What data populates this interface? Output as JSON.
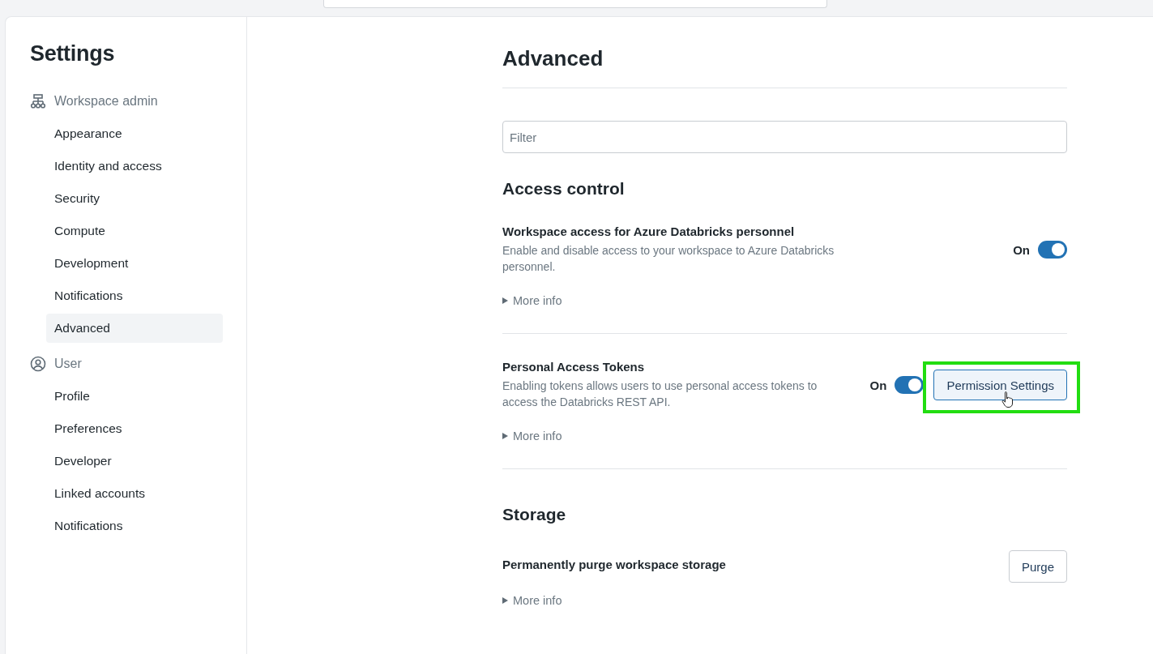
{
  "sidebar": {
    "title": "Settings",
    "groups": [
      {
        "label": "Workspace admin",
        "kind": "workspace",
        "items": [
          {
            "label": "Appearance",
            "selected": false
          },
          {
            "label": "Identity and access",
            "selected": false
          },
          {
            "label": "Security",
            "selected": false
          },
          {
            "label": "Compute",
            "selected": false
          },
          {
            "label": "Development",
            "selected": false
          },
          {
            "label": "Notifications",
            "selected": false
          },
          {
            "label": "Advanced",
            "selected": true
          }
        ]
      },
      {
        "label": "User",
        "kind": "user",
        "items": [
          {
            "label": "Profile",
            "selected": false
          },
          {
            "label": "Preferences",
            "selected": false
          },
          {
            "label": "Developer",
            "selected": false
          },
          {
            "label": "Linked accounts",
            "selected": false
          },
          {
            "label": "Notifications",
            "selected": false
          }
        ]
      }
    ]
  },
  "content": {
    "title": "Advanced",
    "filter": {
      "placeholder": "Filter"
    },
    "sections": [
      {
        "heading": "Access control",
        "settings": [
          {
            "title": "Workspace access for Azure Databricks personnel",
            "description": "Enable and disable access to your workspace to Azure Databricks personnel.",
            "toggle": {
              "label": "On",
              "on": true
            },
            "more_info": "More info"
          },
          {
            "title": "Personal Access Tokens",
            "description": "Enabling tokens allows users to use personal access tokens to access the Databricks REST API.",
            "toggle": {
              "label": "On",
              "on": true
            },
            "button": {
              "label": "Permission Settings",
              "highlighted": true
            },
            "more_info": "More info"
          }
        ]
      },
      {
        "heading": "Storage",
        "settings": [
          {
            "title": "Permanently purge workspace storage",
            "button": {
              "label": "Purge",
              "highlighted": false
            },
            "more_info": "More info"
          }
        ]
      }
    ]
  }
}
